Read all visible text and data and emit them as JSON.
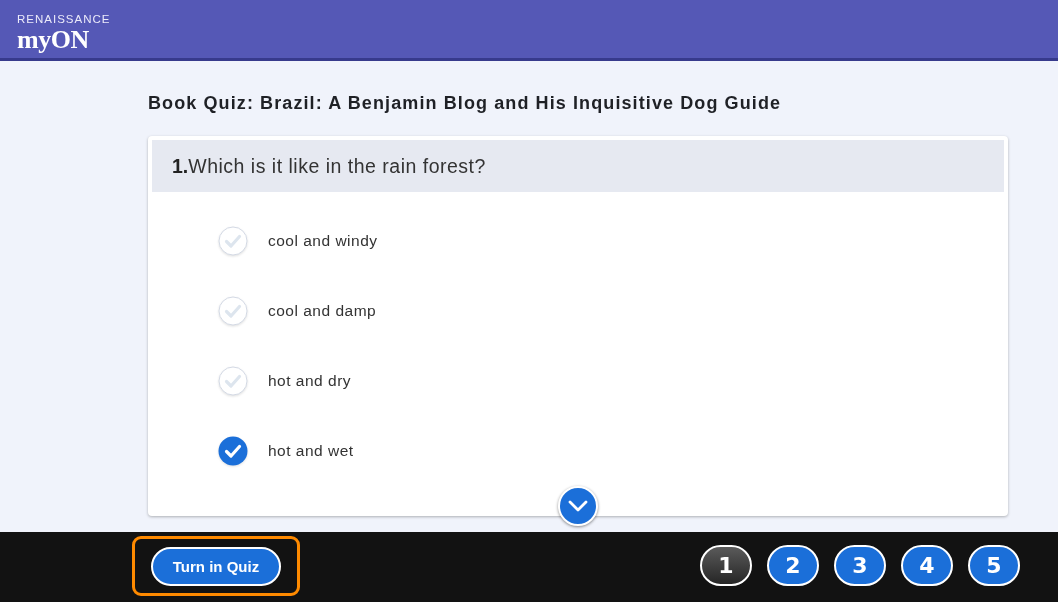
{
  "header": {
    "brand_small": "RENAISSANCE",
    "brand_name": "myON"
  },
  "quiz_title": "Book Quiz: Brazil: A Benjamin Blog and His Inquisitive Dog Guide",
  "question": {
    "number": "1.",
    "text": "Which is it like in the rain forest?",
    "options": [
      {
        "label": "cool and windy",
        "selected": false
      },
      {
        "label": "cool and damp",
        "selected": false
      },
      {
        "label": "hot and dry",
        "selected": false
      },
      {
        "label": "hot and wet",
        "selected": true
      }
    ]
  },
  "turn_in_button": {
    "label": "Turn in Quiz",
    "focused": true
  },
  "question_nav": [
    {
      "label": "1",
      "selected": true
    },
    {
      "label": "2",
      "selected": false
    },
    {
      "label": "3",
      "selected": false
    },
    {
      "label": "4",
      "selected": false
    },
    {
      "label": "5",
      "selected": false
    }
  ]
}
